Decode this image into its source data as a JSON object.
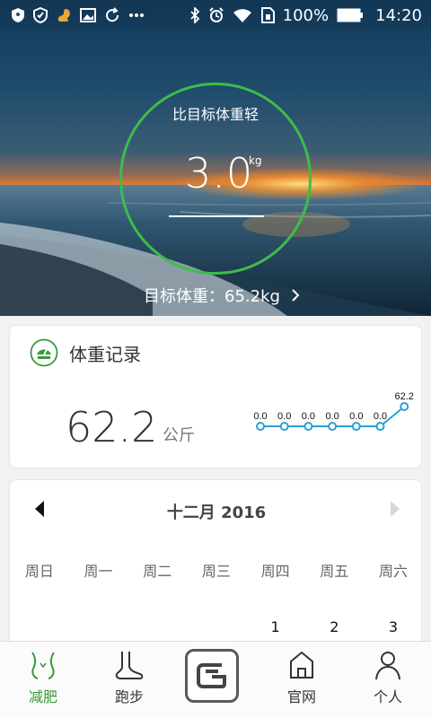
{
  "status_bar": {
    "battery": "100%",
    "time": "14:20",
    "left_icons": [
      "shield-icon",
      "shield-badge-icon",
      "squirrel-icon",
      "image-icon",
      "sync-icon",
      "more-dots-icon"
    ],
    "right_icons": [
      "bluetooth-icon",
      "alarm-icon",
      "wifi-icon",
      "sim-icon",
      "battery-icon"
    ]
  },
  "hero": {
    "label": "比目标体重轻",
    "value": "3.0",
    "unit": "kg",
    "target_label": "目标体重：65.2kg",
    "ring_color": "#3dbd4a"
  },
  "weight_record": {
    "title": "体重记录",
    "value": "62.2",
    "unit": "公斤",
    "trend_labels": [
      "0.0",
      "0.0",
      "0.0",
      "0.0",
      "0.0",
      "0.0",
      "62.2"
    ],
    "trend_values": [
      0,
      0,
      0,
      0,
      0,
      0,
      62.2
    ],
    "accent": "#2b9fd8"
  },
  "calendar": {
    "title": "十二月 2016",
    "weekdays": [
      "周日",
      "周一",
      "周二",
      "周三",
      "周四",
      "周五",
      "周六"
    ],
    "first_row": [
      "",
      "",
      "",
      "",
      "1",
      "2",
      "3"
    ]
  },
  "nav": {
    "items": [
      {
        "label": "减肥",
        "icon": "waist-icon",
        "active": true
      },
      {
        "label": "跑步",
        "icon": "foot-icon",
        "active": false
      },
      {
        "label": "",
        "icon": "center-logo-icon",
        "active": false
      },
      {
        "label": "官网",
        "icon": "home-icon",
        "active": false
      },
      {
        "label": "个人",
        "icon": "person-icon",
        "active": false
      }
    ],
    "active_color": "#3a9a3a"
  }
}
